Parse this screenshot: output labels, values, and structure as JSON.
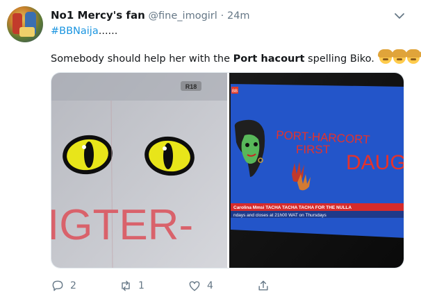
{
  "tweet": {
    "display_name": "No1 Mercy's fan",
    "handle": "@fine_imogirl",
    "separator": "·",
    "time": "24m",
    "hashtag": "#BBNaija",
    "hashtag_suffix": "......",
    "text_before": "Somebody should help her with the ",
    "text_bold": "Port hacourt",
    "text_after": " spelling Biko. ",
    "emoji": "woman-gesturing-no-emoji",
    "emoji_count": 4
  },
  "media": {
    "left_image": {
      "badge": "R18",
      "painted_text": "IGTER-"
    },
    "right_image": {
      "logo": "BB",
      "painted_text_line1": "PORT-HARCORT",
      "painted_text_line2": "FIRST",
      "painted_text_right": "DAUGH",
      "ticker_line1": "Carolina Mmsi TACHA TACHA TACHA FOR THE NULLA",
      "ticker_line2": "ndays and closes at 21h00 WAT on Thursdays"
    }
  },
  "actions": {
    "reply_count": "2",
    "retweet_count": "1",
    "like_count": "4"
  },
  "colors": {
    "link": "#1b95e0",
    "muted": "#657786",
    "text": "#14171a"
  }
}
